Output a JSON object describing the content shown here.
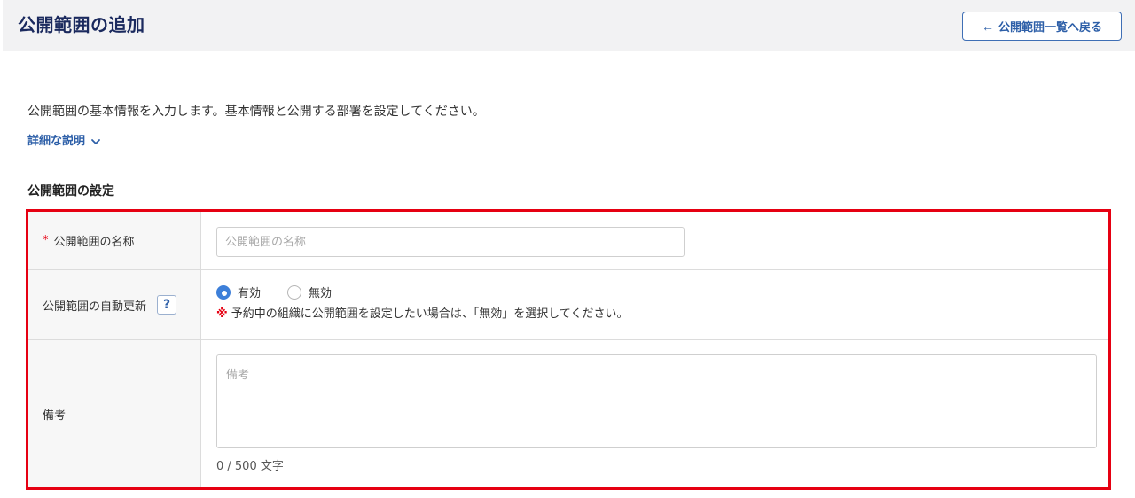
{
  "header": {
    "title": "公開範囲の追加",
    "back_button_arrow": "←",
    "back_button_label": "公開範囲一覧へ戻る"
  },
  "intro": {
    "text": "公開範囲の基本情報を入力します。基本情報と公開する部署を設定してください。",
    "details_link": "詳細な説明"
  },
  "section": {
    "title": "公開範囲の設定"
  },
  "form": {
    "name": {
      "required_mark": "*",
      "label": "公開範囲の名称",
      "placeholder": "公開範囲の名称",
      "value": ""
    },
    "auto_update": {
      "label": "公開範囲の自動更新",
      "help": "?",
      "options": [
        {
          "label": "有効",
          "checked": true
        },
        {
          "label": "無効",
          "checked": false
        }
      ],
      "note_mark": "※",
      "note": "予約中の組織に公開範囲を設定したい場合は、「無効」を選択してください。"
    },
    "remarks": {
      "label": "備考",
      "placeholder": "備考",
      "value": "",
      "char_count": "0 / 500 文字"
    }
  },
  "colors": {
    "title": "#1b2a5e",
    "accent": "#2d5fa8",
    "highlight_border": "#e60012",
    "radio_checked": "#3d7fd9"
  }
}
